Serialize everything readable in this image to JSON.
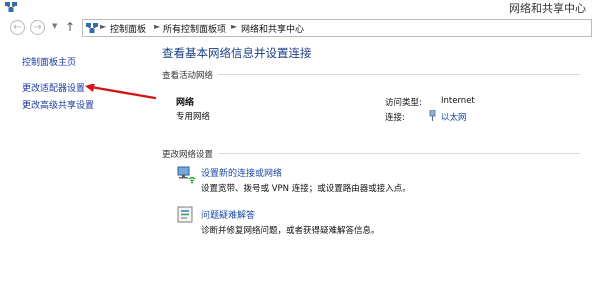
{
  "window": {
    "title": "网络和共享中心"
  },
  "address_bar": {
    "crumbs": [
      "控制面板",
      "所有控制面板项",
      "网络和共享中心"
    ]
  },
  "sidebar": {
    "items": [
      {
        "label": "控制面板主页"
      },
      {
        "label": "更改适配器设置"
      },
      {
        "label": "更改高级共享设置"
      }
    ]
  },
  "main": {
    "title": "查看基本网络信息并设置连接",
    "active_networks": {
      "heading": "查看活动网络",
      "network_name": "网络",
      "network_type": "专用网络",
      "access_type_label": "访问类型:",
      "access_type_value": "Internet",
      "connection_label": "连接:",
      "connection_value": "以太网"
    },
    "change_settings": {
      "heading": "更改网络设置",
      "items": [
        {
          "title": "设置新的连接或网络",
          "desc": "设置宽带、拨号或 VPN 连接；或设置路由器或接入点。",
          "icon": "new-connection-icon"
        },
        {
          "title": "问题疑难解答",
          "desc": "诊断并修复网络问题，或者获得疑难解答信息。",
          "icon": "troubleshoot-icon"
        }
      ]
    }
  },
  "colors": {
    "link": "#1a4aa8",
    "title": "#1c3f86",
    "annotation": "#d01818"
  }
}
